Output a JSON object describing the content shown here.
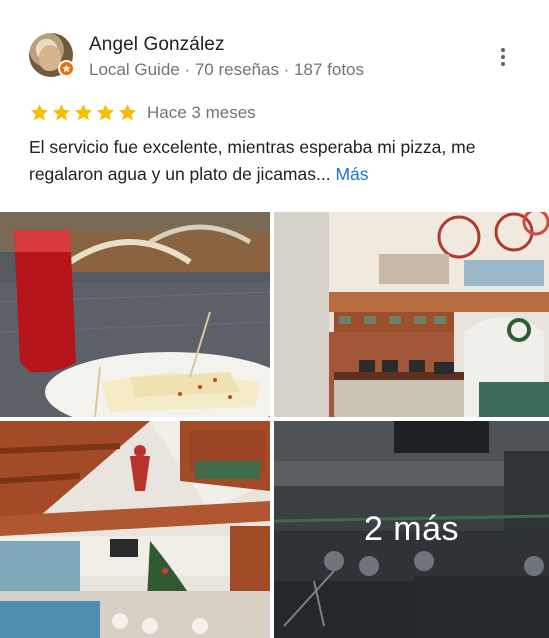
{
  "reviewer": {
    "name": "Angel González",
    "meta": "Local Guide · 70 reseñas · 187 fotos"
  },
  "review": {
    "rating": 5,
    "date": "Hace 3 meses",
    "text": "El servicio fue excelente, mientras esperaba mi pizza, me regalaron agua y un plato de jicamas...",
    "more_label": "Más"
  },
  "photos": {
    "more_overlay": "2 más"
  },
  "colors": {
    "star": "#fbbc04",
    "link": "#1a73e8",
    "local_guide_badge": "#e8710a"
  },
  "icons": [
    "more-vert-icon",
    "star-icon",
    "local-guide-badge-icon"
  ]
}
